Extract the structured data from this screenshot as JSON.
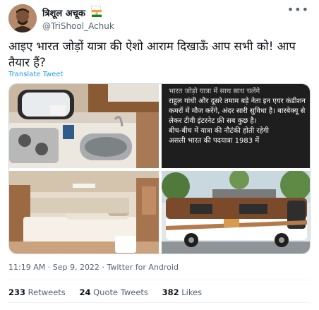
{
  "author": {
    "display_name": "त्रिशूल अचूक",
    "handle": "@TriShool_Achuk",
    "flag_icon": "india-flag-icon"
  },
  "more_icon": "more-options-icon",
  "tweet": {
    "text": "आइए भारत जोड़ों यात्रा की ऐशो आराम दिखाऊँ आप सभी को! आप तैयार हैं?",
    "translate_label": "Translate Tweet"
  },
  "media": {
    "overlay_text": {
      "partial_top": "भारत जोड़ो यात्रा में साथ साथ चलेंगे",
      "para1": "राहुल गांधी और दूसरे तमाम बड़े नेता इन एयर कंडीशन कमरों में मौज करेंगे, अंदर सारी सुविधा है। बारबेक्यू से लेकर टीवी इंटरनेट फ्री सब कुछ है।",
      "para2": "बीच-बीच में यात्रा की नौटंकी होती रहेगी",
      "para3": "असली भारत की पदयात्रा 1983 में"
    }
  },
  "meta": {
    "time": "11:19 AM",
    "separator": "·",
    "date": "Sep 9, 2022",
    "source": "Twitter for Android"
  },
  "stats": {
    "retweets_count": "233",
    "retweets_label": "Retweets",
    "quotes_count": "24",
    "quotes_label": "Quote Tweets",
    "likes_count": "382",
    "likes_label": "Likes"
  }
}
